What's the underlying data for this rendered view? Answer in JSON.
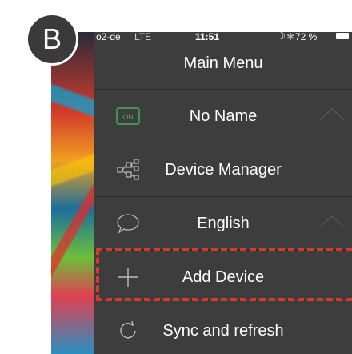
{
  "panel_label": "B",
  "status_bar": {
    "carrier": "o2-de",
    "network": "LTE",
    "time": "11:51",
    "battery": "72 %"
  },
  "menu": {
    "title": "Main Menu",
    "items": [
      {
        "label": "No Name",
        "icon": "on-badge-icon",
        "icon_text": "ON",
        "expandable": true
      },
      {
        "label": "Device Manager",
        "icon": "device-tree-icon",
        "expandable": false
      },
      {
        "label": "English",
        "icon": "speech-bubble-icon",
        "expandable": true
      },
      {
        "label": "Add Device",
        "icon": "plus-icon",
        "expandable": false,
        "highlighted": true
      },
      {
        "label": "Sync and refresh",
        "icon": "refresh-icon",
        "expandable": false
      }
    ]
  },
  "colors": {
    "menu_bg": "#3d3d3d",
    "highlight_border": "#d8382f",
    "on_badge": "#3fae5a",
    "icon_gray": "#bdbdbd"
  }
}
